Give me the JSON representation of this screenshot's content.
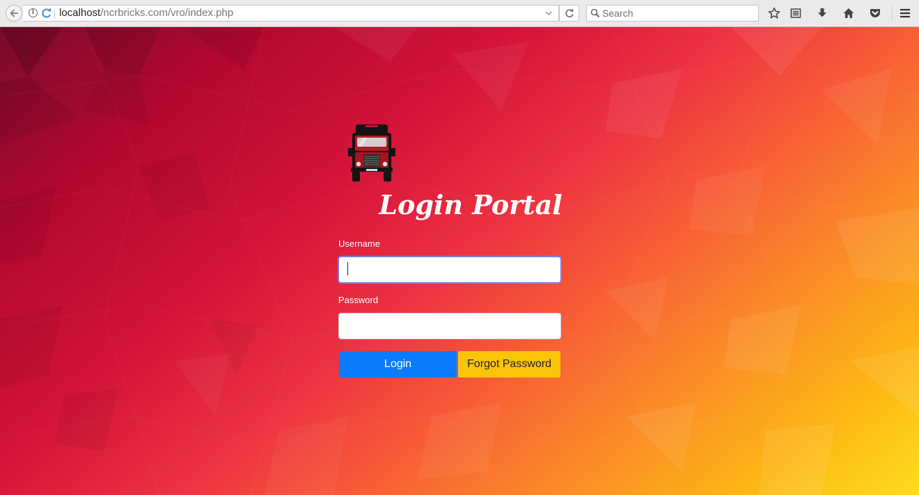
{
  "browser": {
    "url_host": "localhost",
    "url_path": "/ncrbricks.com/vro/index.php",
    "search_placeholder": "Search"
  },
  "login": {
    "title": "Login Portal",
    "username_label": "Username",
    "username_value": "",
    "password_label": "Password",
    "password_value": "",
    "login_button": "Login",
    "forgot_button": "Forgot Password"
  },
  "colors": {
    "login_button": "#0b7cfb",
    "forgot_button": "#fbc409",
    "background_top_left": "#7a0a2c",
    "background_bottom_right": "#fedc1e"
  }
}
